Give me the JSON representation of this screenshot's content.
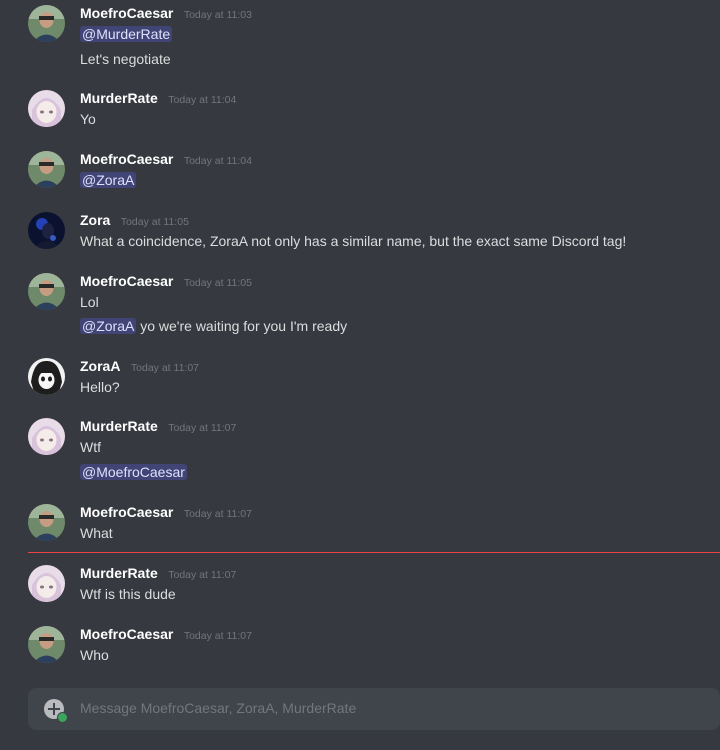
{
  "messages": [
    {
      "user": "MoefroCaesar",
      "time": "Today at 11:03",
      "lines": [
        "@MurderRate",
        "Let's negotiate"
      ]
    },
    {
      "user": "MurderRate",
      "time": "Today at 11:04",
      "lines": [
        "Yo"
      ]
    },
    {
      "user": "MoefroCaesar",
      "time": "Today at 11:04",
      "lines": [
        "@ZoraA"
      ]
    },
    {
      "user": "Zora",
      "time": "Today at 11:05",
      "lines": [
        "What a coincidence, ZoraA not only has a similar name, but the exact same Discord tag!"
      ]
    },
    {
      "user": "MoefroCaesar",
      "time": "Today at 11:05",
      "lines": [
        "Lol"
      ],
      "mention_line": {
        "mention": "@ZoraA",
        "rest": "yo we're waiting for you I'm ready"
      }
    },
    {
      "user": "ZoraA",
      "time": "Today at 11:07",
      "lines": [
        "Hello?"
      ]
    },
    {
      "user": "MurderRate",
      "time": "Today at 11:07",
      "lines": [
        "Wtf",
        "@MoefroCaesar"
      ]
    },
    {
      "user": "MoefroCaesar",
      "time": "Today at 11:07",
      "lines": [
        "What"
      ]
    },
    {
      "user": "MurderRate",
      "time": "Today at 11:07",
      "lines": [
        "Wtf is this dude"
      ]
    },
    {
      "user": "MoefroCaesar",
      "time": "Today at 11:07",
      "lines": [
        "Who"
      ]
    }
  ],
  "composer": {
    "placeholder": "Message MoefroCaesar, ZoraA, MurderRate",
    "add_icon": "plus-circle-icon"
  },
  "colors": {
    "background": "#36393f",
    "composer": "#40444b",
    "mention_bg": "#3e4270",
    "mention_text": "#dee0fc",
    "new_messages_divider": "#ed4245"
  }
}
